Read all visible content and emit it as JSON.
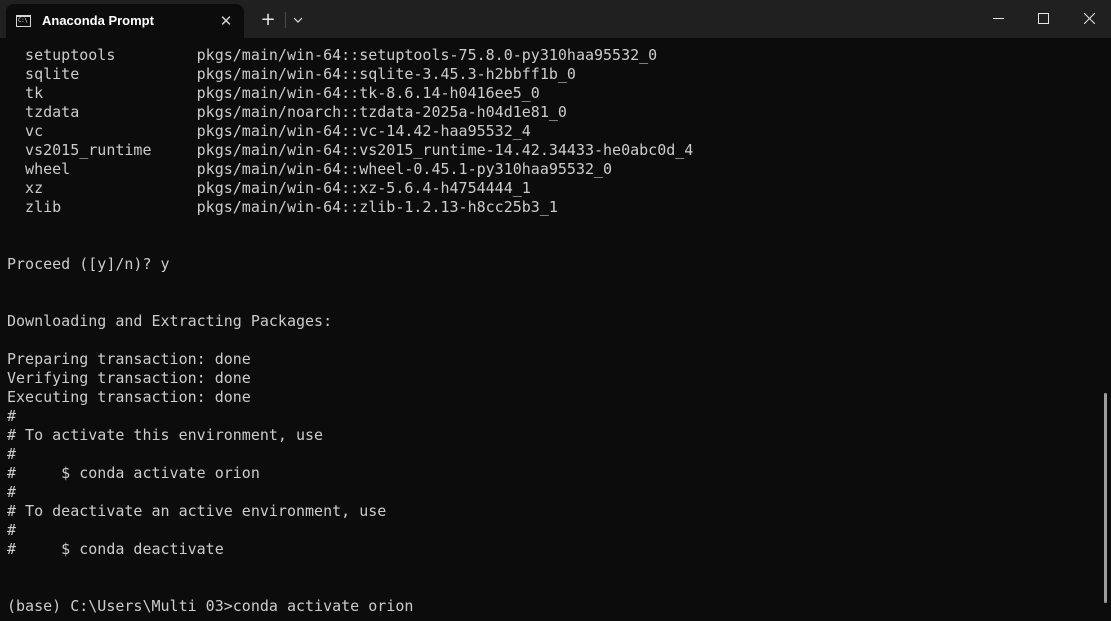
{
  "window": {
    "tab_title": "Anaconda Prompt",
    "tab_icon_text": "C:\\",
    "close_tab_glyph": "✕",
    "new_tab_glyph": "+"
  },
  "terminal": {
    "lines": [
      "  setuptools         pkgs/main/win-64::setuptools-75.8.0-py310haa95532_0",
      "  sqlite             pkgs/main/win-64::sqlite-3.45.3-h2bbff1b_0",
      "  tk                 pkgs/main/win-64::tk-8.6.14-h0416ee5_0",
      "  tzdata             pkgs/main/noarch::tzdata-2025a-h04d1e81_0",
      "  vc                 pkgs/main/win-64::vc-14.42-haa95532_4",
      "  vs2015_runtime     pkgs/main/win-64::vs2015_runtime-14.42.34433-he0abc0d_4",
      "  wheel              pkgs/main/win-64::wheel-0.45.1-py310haa95532_0",
      "  xz                 pkgs/main/win-64::xz-5.6.4-h4754444_1",
      "  zlib               pkgs/main/win-64::zlib-1.2.13-h8cc25b3_1",
      "",
      "",
      "Proceed ([y]/n)? y",
      "",
      "",
      "Downloading and Extracting Packages:",
      "",
      "Preparing transaction: done",
      "Verifying transaction: done",
      "Executing transaction: done",
      "#",
      "# To activate this environment, use",
      "#",
      "#     $ conda activate orion",
      "#",
      "# To deactivate an active environment, use",
      "#",
      "#     $ conda deactivate",
      "",
      "",
      "(base) C:\\Users\\Multi 03>conda activate orion"
    ]
  },
  "colors": {
    "background": "#0c0c0c",
    "titlebar": "#202020",
    "text": "#cccccc"
  }
}
